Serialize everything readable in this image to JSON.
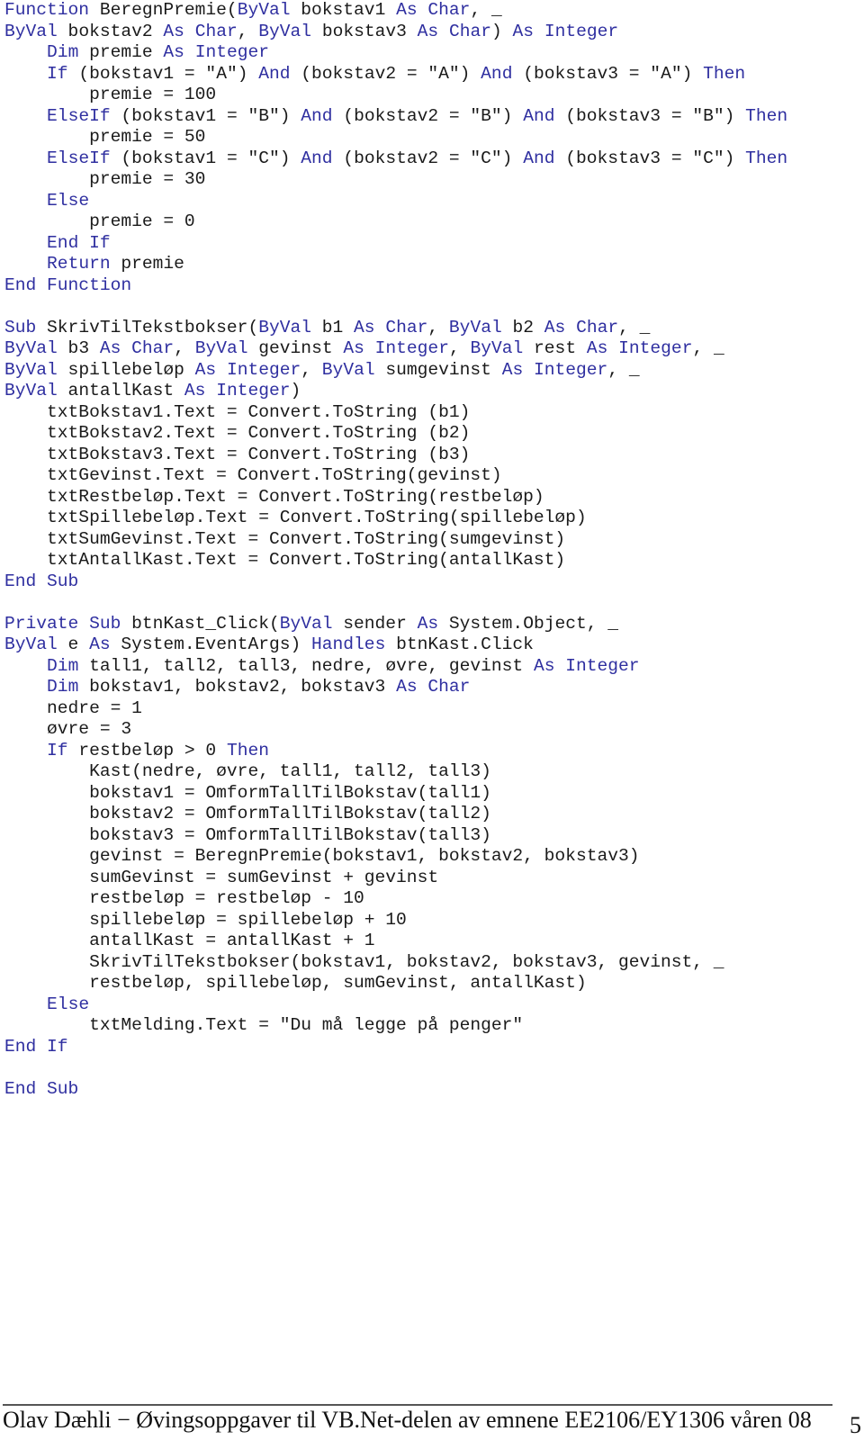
{
  "code": {
    "language": "VB.NET",
    "keyword_color": "#2f2fa0",
    "text_color": "#1a1a1a",
    "lines": [
      [
        [
          "kw",
          "Function"
        ],
        [
          "t",
          " BeregnPremie("
        ],
        [
          "kw",
          "ByVal"
        ],
        [
          "t",
          " bokstav1 "
        ],
        [
          "kw",
          "As"
        ],
        [
          "t",
          " "
        ],
        [
          "kw",
          "Char"
        ],
        [
          "t",
          ", _"
        ]
      ],
      [
        [
          "kw",
          "ByVal"
        ],
        [
          "t",
          " bokstav2 "
        ],
        [
          "kw",
          "As"
        ],
        [
          "t",
          " "
        ],
        [
          "kw",
          "Char"
        ],
        [
          "t",
          ", "
        ],
        [
          "kw",
          "ByVal"
        ],
        [
          "t",
          " bokstav3 "
        ],
        [
          "kw",
          "As"
        ],
        [
          "t",
          " "
        ],
        [
          "kw",
          "Char"
        ],
        [
          "t",
          ") "
        ],
        [
          "kw",
          "As"
        ],
        [
          "t",
          " "
        ],
        [
          "kw",
          "Integer"
        ]
      ],
      [
        [
          "t",
          "    "
        ],
        [
          "kw",
          "Dim"
        ],
        [
          "t",
          " premie "
        ],
        [
          "kw",
          "As"
        ],
        [
          "t",
          " "
        ],
        [
          "kw",
          "Integer"
        ]
      ],
      [
        [
          "t",
          "    "
        ],
        [
          "kw",
          "If"
        ],
        [
          "t",
          " (bokstav1 = \"A\") "
        ],
        [
          "kw",
          "And"
        ],
        [
          "t",
          " (bokstav2 = \"A\") "
        ],
        [
          "kw",
          "And"
        ],
        [
          "t",
          " (bokstav3 = \"A\") "
        ],
        [
          "kw",
          "Then"
        ]
      ],
      [
        [
          "t",
          "        premie = 100"
        ]
      ],
      [
        [
          "t",
          "    "
        ],
        [
          "kw",
          "ElseIf"
        ],
        [
          "t",
          " (bokstav1 = \"B\") "
        ],
        [
          "kw",
          "And"
        ],
        [
          "t",
          " (bokstav2 = \"B\") "
        ],
        [
          "kw",
          "And"
        ],
        [
          "t",
          " (bokstav3 = \"B\") "
        ],
        [
          "kw",
          "Then"
        ]
      ],
      [
        [
          "t",
          "        premie = 50"
        ]
      ],
      [
        [
          "t",
          "    "
        ],
        [
          "kw",
          "ElseIf"
        ],
        [
          "t",
          " (bokstav1 = \"C\") "
        ],
        [
          "kw",
          "And"
        ],
        [
          "t",
          " (bokstav2 = \"C\") "
        ],
        [
          "kw",
          "And"
        ],
        [
          "t",
          " (bokstav3 = \"C\") "
        ],
        [
          "kw",
          "Then"
        ]
      ],
      [
        [
          "t",
          "        premie = 30"
        ]
      ],
      [
        [
          "t",
          "    "
        ],
        [
          "kw",
          "Else"
        ]
      ],
      [
        [
          "t",
          "        premie = 0"
        ]
      ],
      [
        [
          "t",
          "    "
        ],
        [
          "kw",
          "End If"
        ]
      ],
      [
        [
          "t",
          "    "
        ],
        [
          "kw",
          "Return"
        ],
        [
          "t",
          " premie"
        ]
      ],
      [
        [
          "kw",
          "End Function"
        ]
      ],
      [],
      [
        [
          "kw",
          "Sub"
        ],
        [
          "t",
          " SkrivTilTekstbokser("
        ],
        [
          "kw",
          "ByVal"
        ],
        [
          "t",
          " b1 "
        ],
        [
          "kw",
          "As"
        ],
        [
          "t",
          " "
        ],
        [
          "kw",
          "Char"
        ],
        [
          "t",
          ", "
        ],
        [
          "kw",
          "ByVal"
        ],
        [
          "t",
          " b2 "
        ],
        [
          "kw",
          "As"
        ],
        [
          "t",
          " "
        ],
        [
          "kw",
          "Char"
        ],
        [
          "t",
          ", _"
        ]
      ],
      [
        [
          "kw",
          "ByVal"
        ],
        [
          "t",
          " b3 "
        ],
        [
          "kw",
          "As"
        ],
        [
          "t",
          " "
        ],
        [
          "kw",
          "Char"
        ],
        [
          "t",
          ", "
        ],
        [
          "kw",
          "ByVal"
        ],
        [
          "t",
          " gevinst "
        ],
        [
          "kw",
          "As"
        ],
        [
          "t",
          " "
        ],
        [
          "kw",
          "Integer"
        ],
        [
          "t",
          ", "
        ],
        [
          "kw",
          "ByVal"
        ],
        [
          "t",
          " rest "
        ],
        [
          "kw",
          "As"
        ],
        [
          "t",
          " "
        ],
        [
          "kw",
          "Integer"
        ],
        [
          "t",
          ", _"
        ]
      ],
      [
        [
          "kw",
          "ByVal"
        ],
        [
          "t",
          " spillebeløp "
        ],
        [
          "kw",
          "As"
        ],
        [
          "t",
          " "
        ],
        [
          "kw",
          "Integer"
        ],
        [
          "t",
          ", "
        ],
        [
          "kw",
          "ByVal"
        ],
        [
          "t",
          " sumgevinst "
        ],
        [
          "kw",
          "As"
        ],
        [
          "t",
          " "
        ],
        [
          "kw",
          "Integer"
        ],
        [
          "t",
          ", _"
        ]
      ],
      [
        [
          "kw",
          "ByVal"
        ],
        [
          "t",
          " antallKast "
        ],
        [
          "kw",
          "As"
        ],
        [
          "t",
          " "
        ],
        [
          "kw",
          "Integer"
        ],
        [
          "t",
          ")"
        ]
      ],
      [
        [
          "t",
          "    txtBokstav1.Text = Convert.ToString (b1)"
        ]
      ],
      [
        [
          "t",
          "    txtBokstav2.Text = Convert.ToString (b2)"
        ]
      ],
      [
        [
          "t",
          "    txtBokstav3.Text = Convert.ToString (b3)"
        ]
      ],
      [
        [
          "t",
          "    txtGevinst.Text = Convert.ToString(gevinst)"
        ]
      ],
      [
        [
          "t",
          "    txtRestbeløp.Text = Convert.ToString(restbeløp)"
        ]
      ],
      [
        [
          "t",
          "    txtSpillebeløp.Text = Convert.ToString(spillebeløp)"
        ]
      ],
      [
        [
          "t",
          "    txtSumGevinst.Text = Convert.ToString(sumgevinst)"
        ]
      ],
      [
        [
          "t",
          "    txtAntallKast.Text = Convert.ToString(antallKast)"
        ]
      ],
      [
        [
          "kw",
          "End Sub"
        ]
      ],
      [],
      [
        [
          "kw",
          "Private Sub"
        ],
        [
          "t",
          " btnKast_Click("
        ],
        [
          "kw",
          "ByVal"
        ],
        [
          "t",
          " sender "
        ],
        [
          "kw",
          "As"
        ],
        [
          "t",
          " System.Object, _"
        ]
      ],
      [
        [
          "kw",
          "ByVal"
        ],
        [
          "t",
          " e "
        ],
        [
          "kw",
          "As"
        ],
        [
          "t",
          " System.EventArgs) "
        ],
        [
          "kw",
          "Handles"
        ],
        [
          "t",
          " btnKast.Click"
        ]
      ],
      [
        [
          "t",
          "    "
        ],
        [
          "kw",
          "Dim"
        ],
        [
          "t",
          " tall1, tall2, tall3, nedre, øvre, gevinst "
        ],
        [
          "kw",
          "As"
        ],
        [
          "t",
          " "
        ],
        [
          "kw",
          "Integer"
        ]
      ],
      [
        [
          "t",
          "    "
        ],
        [
          "kw",
          "Dim"
        ],
        [
          "t",
          " bokstav1, bokstav2, bokstav3 "
        ],
        [
          "kw",
          "As"
        ],
        [
          "t",
          " "
        ],
        [
          "kw",
          "Char"
        ]
      ],
      [
        [
          "t",
          "    nedre = 1"
        ]
      ],
      [
        [
          "t",
          "    øvre = 3"
        ]
      ],
      [
        [
          "t",
          "    "
        ],
        [
          "kw",
          "If"
        ],
        [
          "t",
          " restbeløp > 0 "
        ],
        [
          "kw",
          "Then"
        ]
      ],
      [
        [
          "t",
          "        Kast(nedre, øvre, tall1, tall2, tall3)"
        ]
      ],
      [
        [
          "t",
          "        bokstav1 = OmformTallTilBokstav(tall1)"
        ]
      ],
      [
        [
          "t",
          "        bokstav2 = OmformTallTilBokstav(tall2)"
        ]
      ],
      [
        [
          "t",
          "        bokstav3 = OmformTallTilBokstav(tall3)"
        ]
      ],
      [
        [
          "t",
          "        gevinst = BeregnPremie(bokstav1, bokstav2, bokstav3)"
        ]
      ],
      [
        [
          "t",
          "        sumGevinst = sumGevinst + gevinst"
        ]
      ],
      [
        [
          "t",
          "        restbeløp = restbeløp - 10"
        ]
      ],
      [
        [
          "t",
          "        spillebeløp = spillebeløp + 10"
        ]
      ],
      [
        [
          "t",
          "        antallKast = antallKast + 1"
        ]
      ],
      [
        [
          "t",
          "        SkrivTilTekstbokser(bokstav1, bokstav2, bokstav3, gevinst, _"
        ]
      ],
      [
        [
          "t",
          "        restbeløp, spillebeløp, sumGevinst, antallKast)"
        ]
      ],
      [
        [
          "t",
          "    "
        ],
        [
          "kw",
          "Else"
        ]
      ],
      [
        [
          "t",
          "        txtMelding.Text = \"Du må legge på penger\""
        ]
      ],
      [
        [
          "kw",
          "End If"
        ]
      ],
      [],
      [
        [
          "kw",
          "End Sub"
        ]
      ]
    ]
  },
  "footer": {
    "text": "Olav Dæhli − Øvingsoppgaver til VB.Net-delen av emnene EE2106/EY1306 våren 08",
    "page_number": "5"
  }
}
